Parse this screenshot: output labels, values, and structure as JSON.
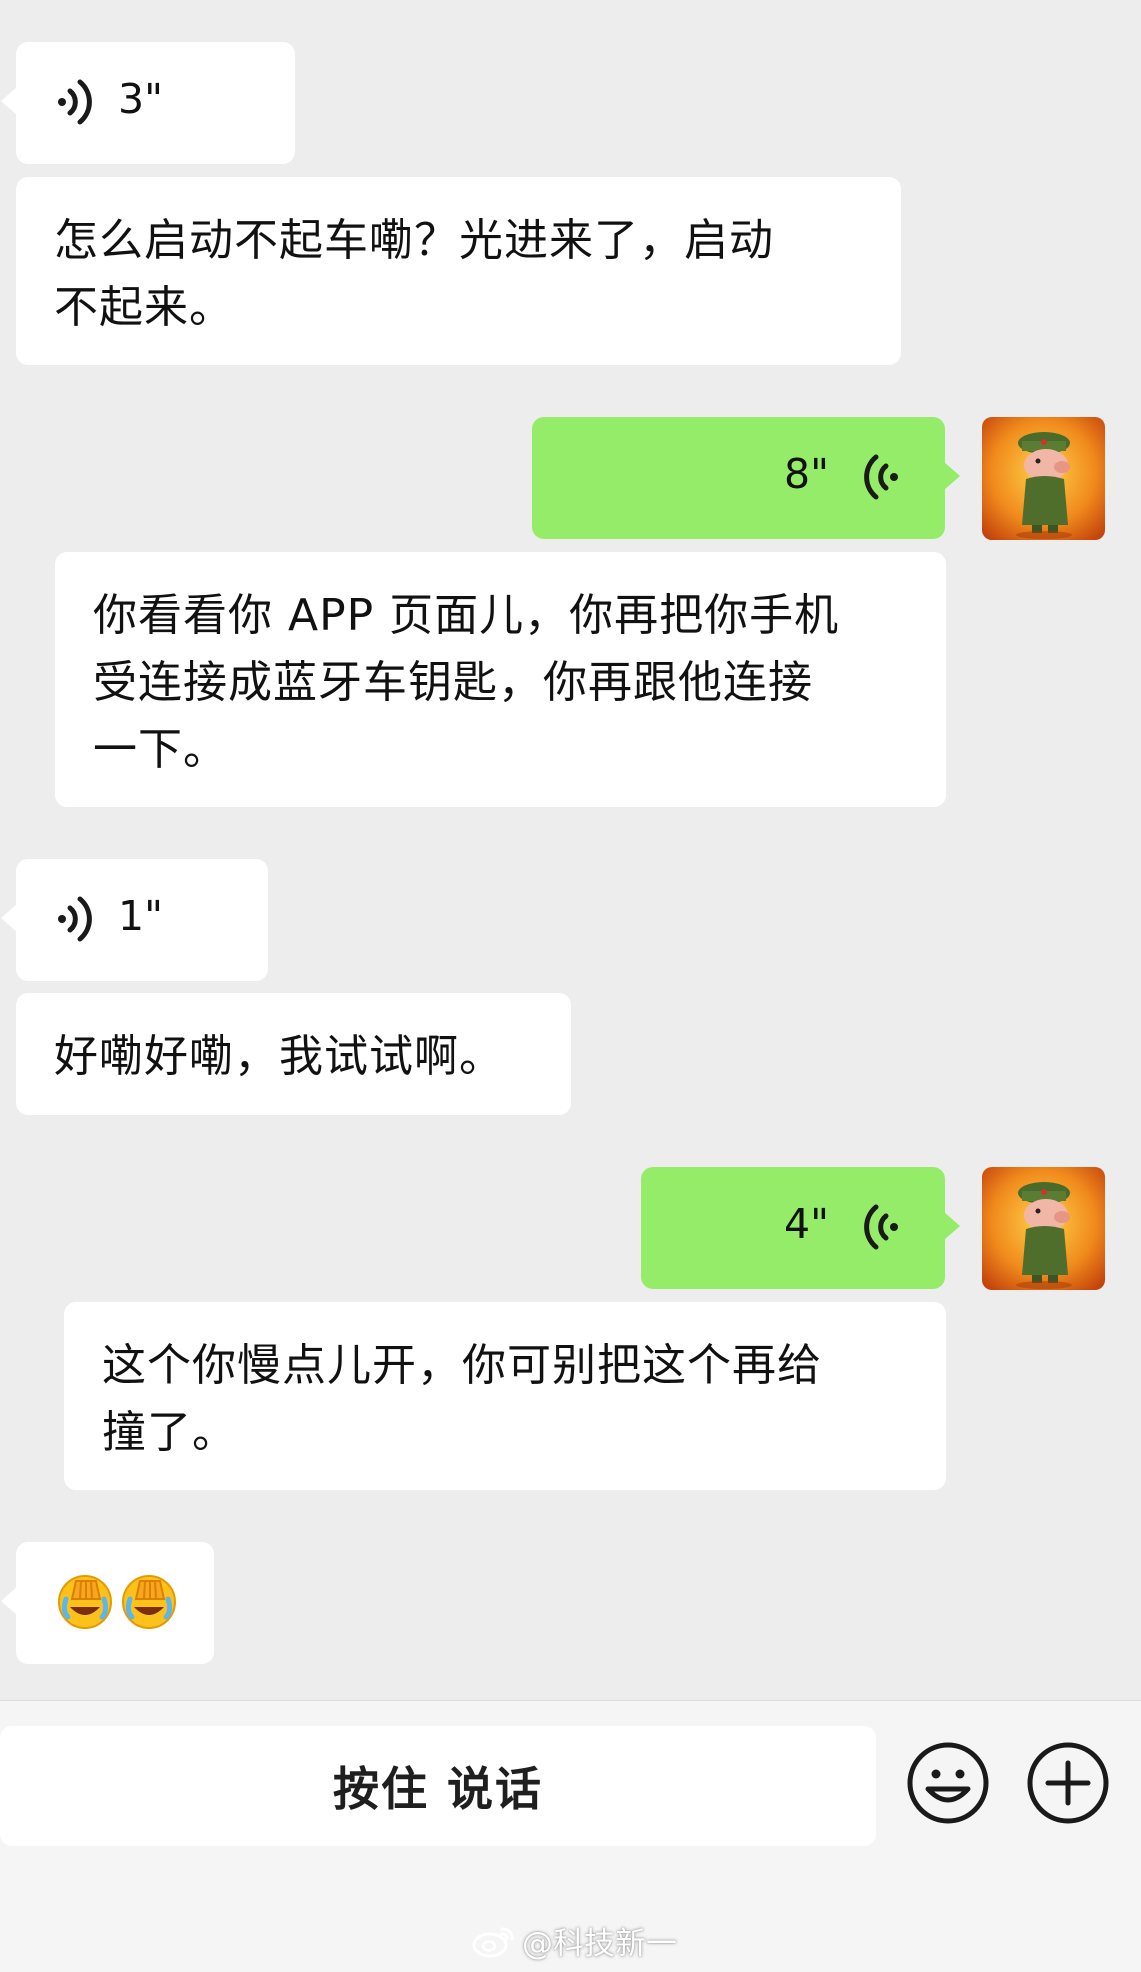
{
  "conversation": {
    "voice_in_1": {
      "duration": "3\""
    },
    "text_in_1": {
      "lines": [
        "怎么启动不起车嘞？光进来了，启动",
        "不起来。"
      ]
    },
    "voice_out_1": {
      "duration": "8\""
    },
    "text_out_1": {
      "lines": [
        "你看看你 APP 页面儿，你再把你手机",
        "受连接成蓝牙车钥匙，你再跟他连接",
        "一下。"
      ]
    },
    "voice_in_2": {
      "duration": "1\""
    },
    "text_in_2": {
      "lines": [
        "好嘞好嘞，我试试啊。"
      ]
    },
    "voice_out_2": {
      "duration": "4\""
    },
    "text_out_2": {
      "lines": [
        "这个你慢点儿开，你可别把这个再给",
        "撞了。"
      ]
    },
    "emoji_in_1": {
      "emojis": [
        "😂",
        "😂"
      ],
      "icon": "face-palm-crying-emoji"
    }
  },
  "input_bar": {
    "talk_label": "按住 说话",
    "emoji_icon": "smiley-face-icon",
    "plus_icon": "plus-circle-icon"
  },
  "watermark": {
    "text": "@科技新一",
    "icon": "weibo-icon"
  },
  "colors": {
    "background": "#ededed",
    "incoming_bubble": "#ffffff",
    "outgoing_bubble": "#95ec69",
    "text": "#111111"
  }
}
